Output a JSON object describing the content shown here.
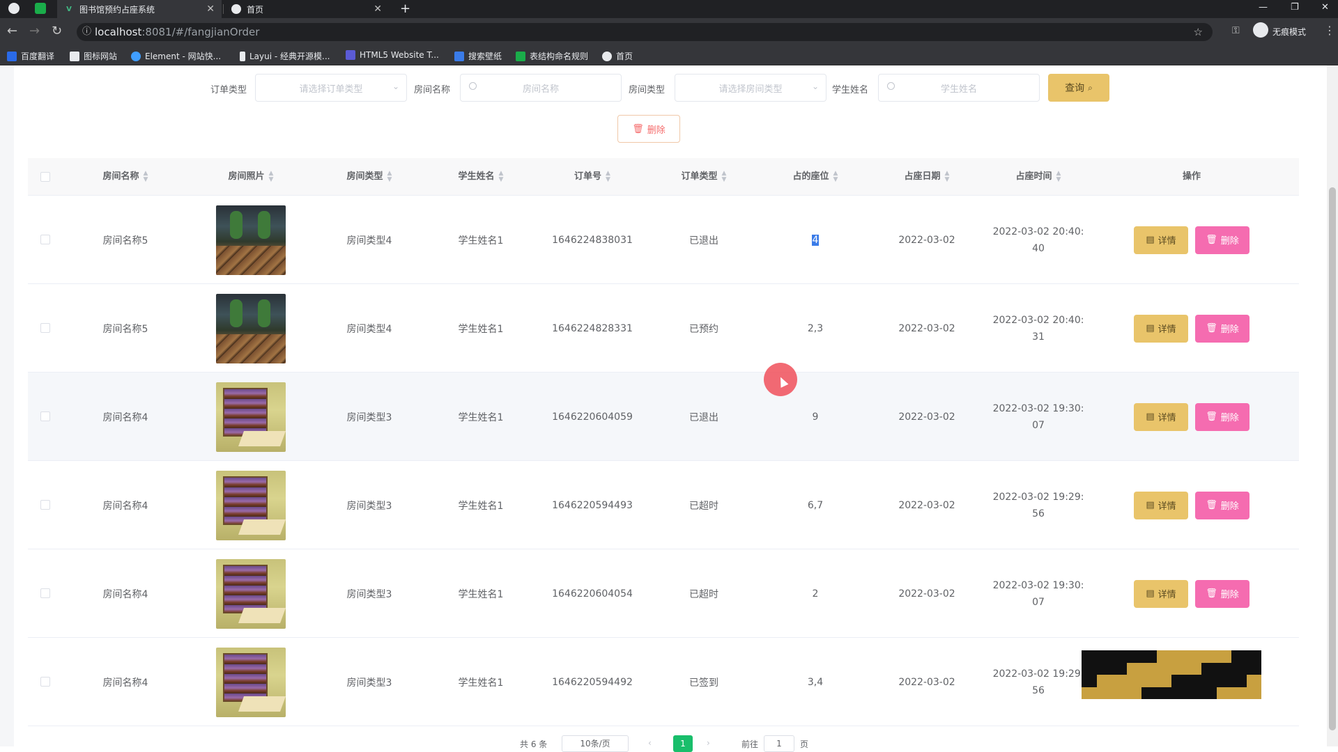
{
  "browser": {
    "tabs": [
      {
        "title": "图书馆预约占座系统"
      },
      {
        "title": "首页"
      }
    ],
    "url_host": "localhost",
    "url_path": ":8081/#/fangjianOrder",
    "incognito_label": "无痕模式",
    "bookmarks": [
      "百度翻译",
      "图标网站",
      "Element - 网站快...",
      "Layui - 经典开源模...",
      "HTML5 Website T...",
      "搜索壁纸",
      "表结构命名规则",
      "首页"
    ]
  },
  "search": {
    "order_type_label": "订单类型",
    "order_type_placeholder": "请选择订单类型",
    "room_name_label": "房间名称",
    "room_name_placeholder": "房间名称",
    "room_type_label": "房间类型",
    "room_type_placeholder": "请选择房间类型",
    "student_name_label": "学生姓名",
    "student_name_placeholder": "学生姓名",
    "query_button": "查询"
  },
  "delete_button": "删除",
  "table": {
    "headers": [
      "房间名称",
      "房间照片",
      "房间类型",
      "学生姓名",
      "订单号",
      "订单类型",
      "占的座位",
      "占座日期",
      "占座时间",
      "操作"
    ],
    "rows": [
      {
        "room_name": "房间名称5",
        "photo": "hall",
        "room_type": "房间类型4",
        "student": "学生姓名1",
        "order_no": "1646224838031",
        "order_type": "已退出",
        "seat": "4",
        "date": "2022-03-02",
        "time": "2022-03-02 20:40:40"
      },
      {
        "room_name": "房间名称5",
        "photo": "hall",
        "room_type": "房间类型4",
        "student": "学生姓名1",
        "order_no": "1646224828331",
        "order_type": "已预约",
        "seat": "2,3",
        "date": "2022-03-02",
        "time": "2022-03-02 20:40:31"
      },
      {
        "room_name": "房间名称4",
        "photo": "shelf",
        "room_type": "房间类型3",
        "student": "学生姓名1",
        "order_no": "1646220604059",
        "order_type": "已退出",
        "seat": "9",
        "date": "2022-03-02",
        "time": "2022-03-02 19:30:07"
      },
      {
        "room_name": "房间名称4",
        "photo": "shelf",
        "room_type": "房间类型3",
        "student": "学生姓名1",
        "order_no": "1646220594493",
        "order_type": "已超时",
        "seat": "6,7",
        "date": "2022-03-02",
        "time": "2022-03-02 19:29:56"
      },
      {
        "room_name": "房间名称4",
        "photo": "shelf",
        "room_type": "房间类型3",
        "student": "学生姓名1",
        "order_no": "1646220604054",
        "order_type": "已超时",
        "seat": "2",
        "date": "2022-03-02",
        "time": "2022-03-02 19:30:07"
      },
      {
        "room_name": "房间名称4",
        "photo": "shelf",
        "room_type": "房间类型3",
        "student": "学生姓名1",
        "order_no": "1646220594492",
        "order_type": "已签到",
        "seat": "3,4",
        "date": "2022-03-02",
        "time": "2022-03-02 19:29:56"
      }
    ],
    "detail_button": "详情",
    "delete_button": "删除"
  },
  "pagination": {
    "total": "共 6 条",
    "page_size": "10条/页",
    "current_page": "1",
    "goto_label": "前往",
    "goto_value": "1",
    "page_suffix": "页"
  },
  "colors": {
    "accent_yellow": "#e9c46a",
    "delete_pink": "#f56cb0",
    "pager_active": "#19be6b"
  }
}
